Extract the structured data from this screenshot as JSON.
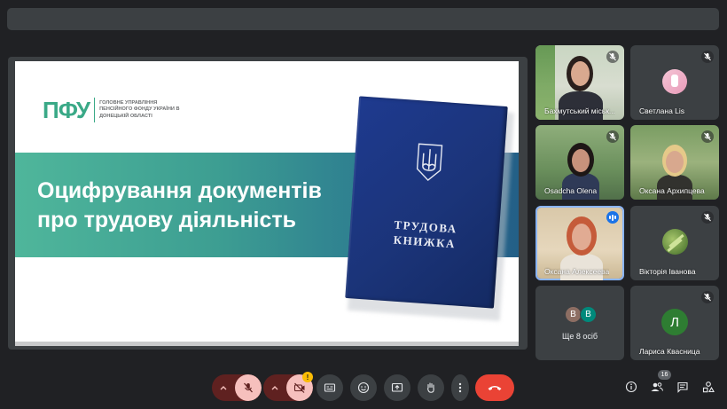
{
  "presentation": {
    "logo_mark": "ПФУ",
    "logo_text": "ГОЛОВНЕ УПРАВЛІННЯ ПЕНСІЙНОГО ФОНДУ УКРАЇНИ В ДОНЕЦЬКІЙ ОБЛАСТІ",
    "title_line1": "Оцифрування документів",
    "title_line2": "про трудову діяльність",
    "book_line1": "ТРУДОВА",
    "book_line2": "КНИЖКА"
  },
  "participants": [
    {
      "name": "Бахмутський міськ...",
      "muted": true
    },
    {
      "name": "Светлана Lis",
      "muted": true
    },
    {
      "name": "Osadcha Olena",
      "muted": true
    },
    {
      "name": "Оксана Архипцева",
      "muted": true
    },
    {
      "name": "Оксана Алексеева",
      "muted": false,
      "speaking": true
    },
    {
      "name": "Вікторія Іванова",
      "muted": true
    },
    {
      "name": "Лариса Квасница",
      "muted": true,
      "initial": "Л"
    }
  ],
  "more_tile": {
    "label": "Ще 8 осіб",
    "avatar1": "В",
    "avatar2": "В"
  },
  "controls": {
    "participants_count": "16",
    "camera_warning": "!"
  },
  "colors": {
    "background": "#202124",
    "tile": "#3c4043",
    "end_call": "#ea4335",
    "muted_red": "#f6c0bd",
    "active_border": "#8ab4f8",
    "avatar_green": "#2e7d32"
  },
  "icons": [
    "mic-off-icon",
    "camera-off-icon",
    "captions-icon",
    "emoji-icon",
    "present-icon",
    "raise-hand-icon",
    "more-options-icon",
    "end-call-icon",
    "info-icon",
    "people-icon",
    "chat-icon",
    "activities-icon"
  ]
}
